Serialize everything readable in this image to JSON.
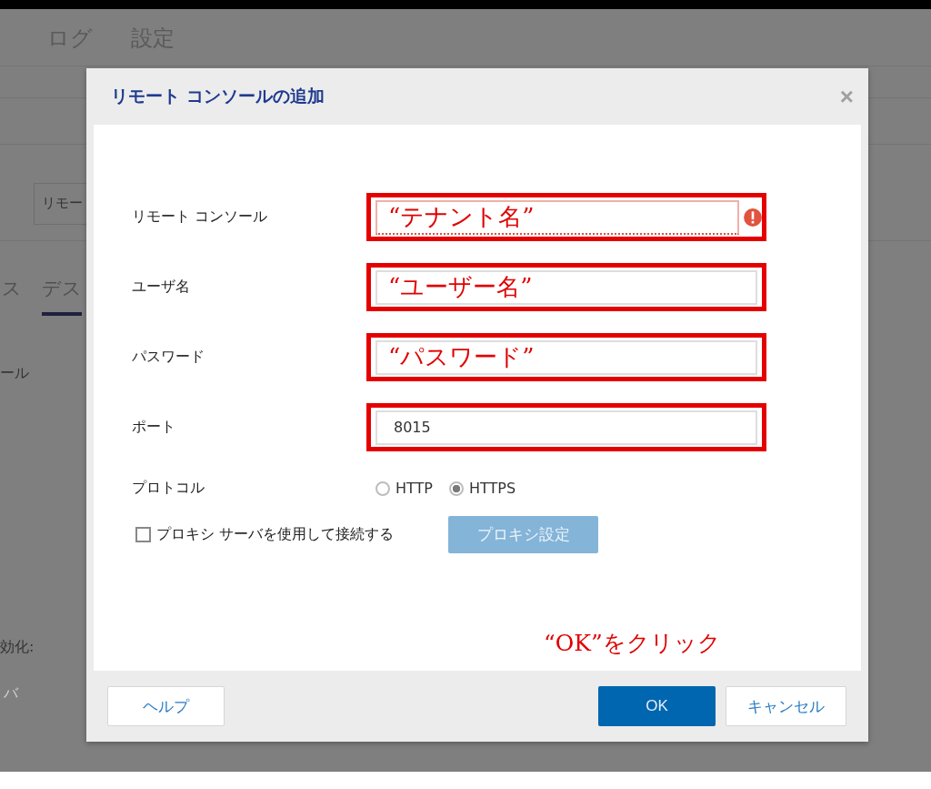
{
  "background": {
    "menu": [
      "ログ",
      "設定"
    ],
    "dropdown": {
      "value": "リモー"
    },
    "tabs": [
      {
        "label": "ス",
        "selected": false
      },
      {
        "label": "デス",
        "selected": true
      }
    ],
    "labels": [
      "ール",
      "効化:"
    ],
    "faint_text": "バ"
  },
  "dialog": {
    "title": "リモート コンソールの追加",
    "close": "×",
    "fields": [
      {
        "label": "リモート コンソール",
        "value": "“テナント名”",
        "kind": "annotation",
        "error": true,
        "highlighted": true
      },
      {
        "label": "ユーザ名",
        "value": "“ユーザー名”",
        "kind": "annotation",
        "error": false,
        "highlighted": true
      },
      {
        "label": "パスワード",
        "value": "“パスワード”",
        "kind": "annotation",
        "error": false,
        "highlighted": true
      },
      {
        "label": "ポート",
        "value": "8015",
        "kind": "plain",
        "error": false,
        "highlighted": true
      }
    ],
    "protocol": {
      "label": "プロトコル",
      "options": [
        {
          "label": "HTTP",
          "selected": false
        },
        {
          "label": "HTTPS",
          "selected": true
        }
      ]
    },
    "proxy": {
      "label": "プロキシ サーバを使用して接続する",
      "checked": false,
      "button": {
        "label": "プロキシ設定",
        "disabled": true
      }
    },
    "annotation": "“OK”をクリック",
    "buttons": [
      {
        "label": "ヘルプ",
        "kind": "help"
      },
      {
        "label": "OK",
        "kind": "primary"
      },
      {
        "label": "キャンセル",
        "kind": "secondary"
      }
    ]
  }
}
